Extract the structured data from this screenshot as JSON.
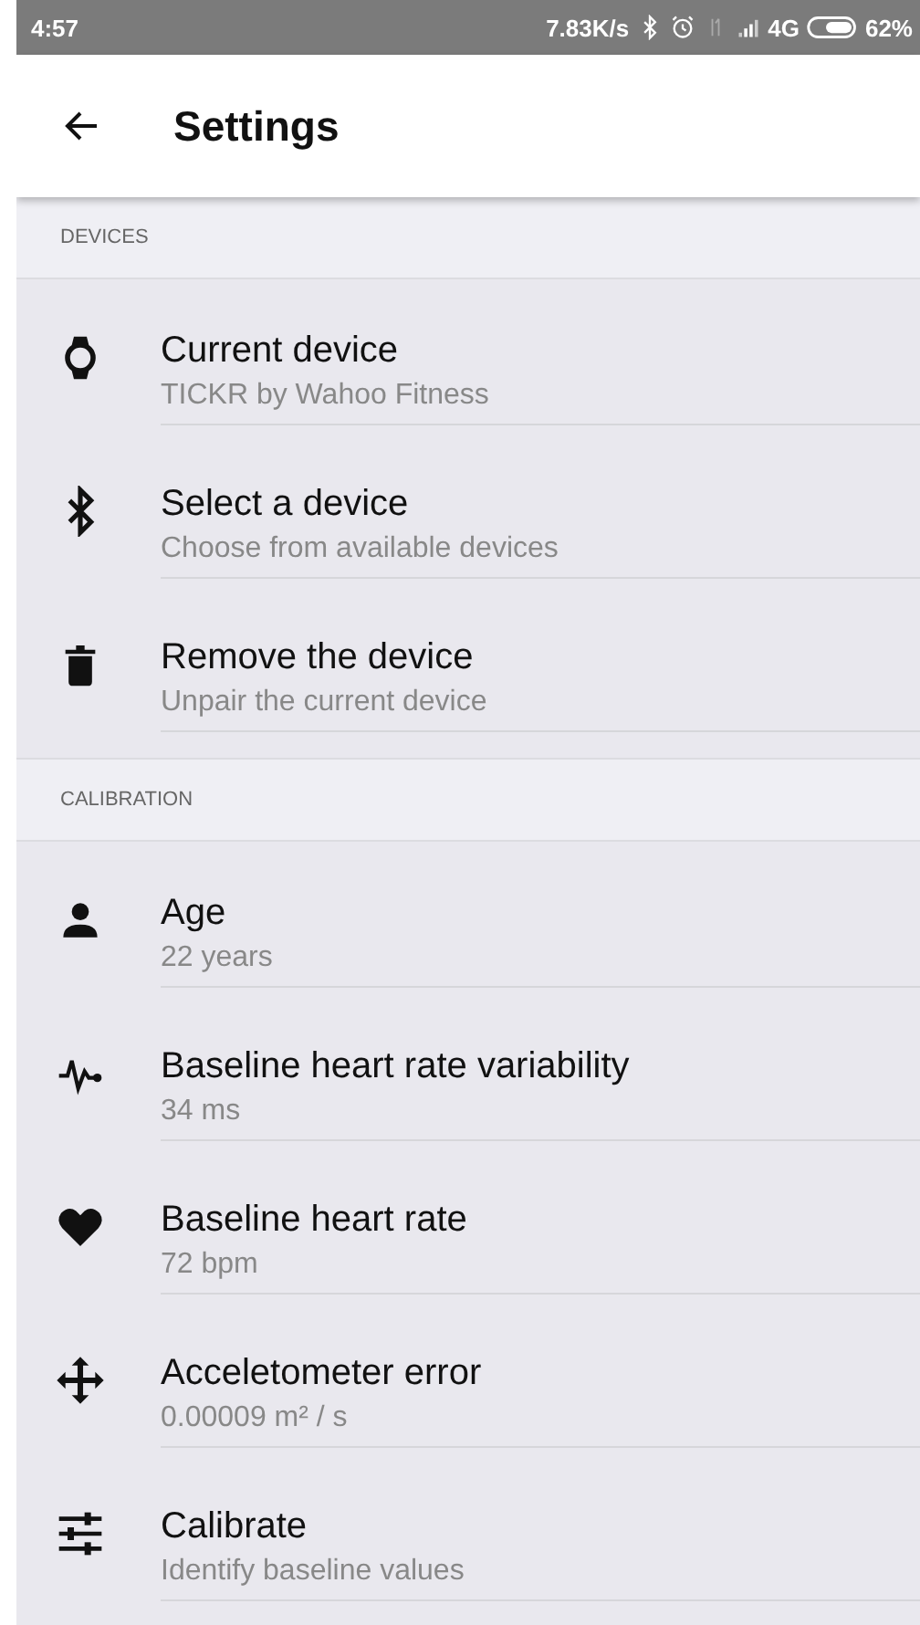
{
  "status_bar": {
    "time": "4:57",
    "speed": "7.83K/s",
    "network": "4G",
    "battery": "62%"
  },
  "toolbar": {
    "title": "Settings"
  },
  "sections": [
    {
      "header": "DEVICES",
      "items": [
        {
          "title": "Current device",
          "subtitle": "TICKR by Wahoo Fitness"
        },
        {
          "title": "Select a device",
          "subtitle": "Choose from available devices"
        },
        {
          "title": "Remove the device",
          "subtitle": "Unpair the current device"
        }
      ]
    },
    {
      "header": "CALIBRATION",
      "items": [
        {
          "title": "Age",
          "subtitle": "22 years"
        },
        {
          "title": "Baseline heart rate variability",
          "subtitle": "34 ms"
        },
        {
          "title": "Baseline heart rate",
          "subtitle": "72 bpm"
        },
        {
          "title": "Acceletometer error",
          "subtitle": "0.00009 m² / s"
        },
        {
          "title": "Calibrate",
          "subtitle": "Identify baseline values"
        }
      ]
    }
  ]
}
